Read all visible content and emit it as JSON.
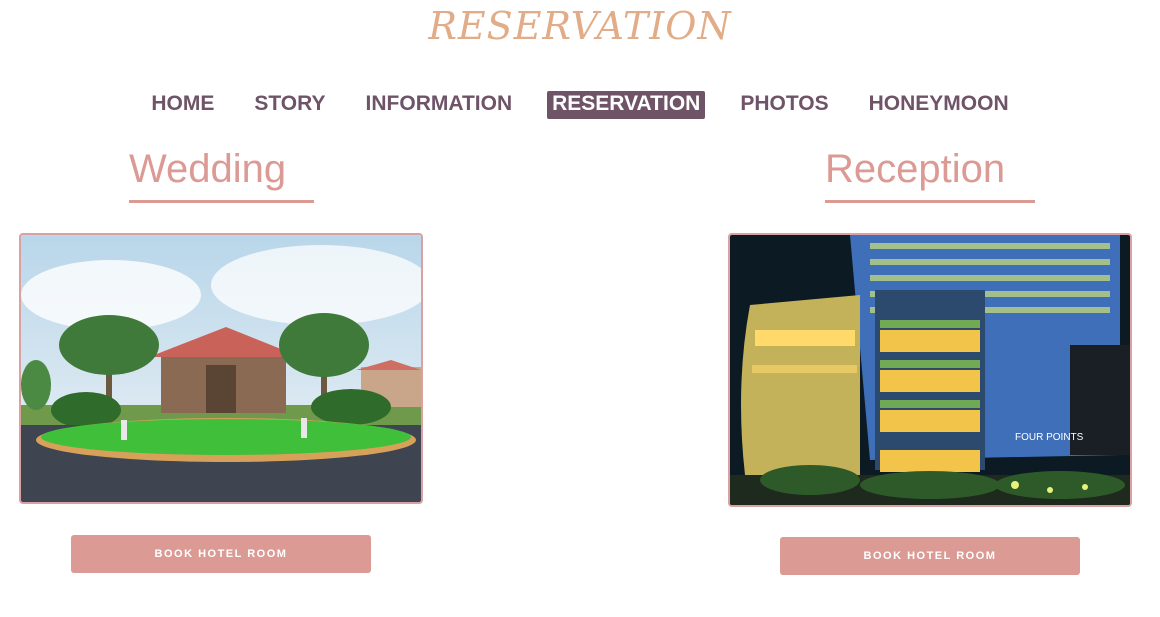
{
  "header": {
    "title": "RESERVATION"
  },
  "nav": {
    "items": [
      {
        "label": "HOME"
      },
      {
        "label": "STORY"
      },
      {
        "label": "INFORMATION"
      },
      {
        "label": "RESERVATION",
        "active": true
      },
      {
        "label": "PHOTOS"
      },
      {
        "label": "HONEYMOON"
      }
    ]
  },
  "sections": {
    "wedding": {
      "heading": "Wedding",
      "button_label": "BOOK HOTEL ROOM"
    },
    "reception": {
      "heading": "Reception",
      "button_label": "BOOK HOTEL ROOM",
      "sign_text": "FOUR POINTS"
    }
  },
  "colors": {
    "title": "#e1ac87",
    "nav_text": "#6f5468",
    "nav_active_bg": "#6f5468",
    "accent": "#dc9a95"
  }
}
